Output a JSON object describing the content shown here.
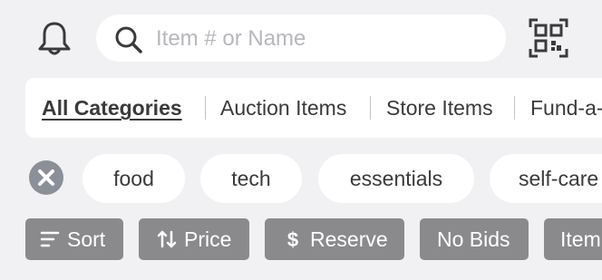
{
  "search": {
    "placeholder": "Item # or Name"
  },
  "categories": {
    "tabs": [
      {
        "label": "All Categories",
        "active": true
      },
      {
        "label": "Auction Items",
        "active": false
      },
      {
        "label": "Store Items",
        "active": false
      },
      {
        "label": "Fund-a-",
        "active": false
      }
    ]
  },
  "tags": {
    "items": [
      {
        "label": "food"
      },
      {
        "label": "tech"
      },
      {
        "label": "essentials"
      },
      {
        "label": "self-care"
      }
    ]
  },
  "filters": {
    "sort_label": "Sort",
    "price_label": "Price",
    "reserve_label": "Reserve",
    "no_bids_label": "No Bids",
    "item_label": "Item"
  },
  "icons": {
    "bell": "bell-icon",
    "search": "search-icon",
    "qr": "qr-code-icon",
    "clear": "close-circle-icon",
    "sort": "sort-lines-icon",
    "price": "up-down-arrows-icon",
    "reserve": "dollar-icon"
  },
  "colors": {
    "background": "#f1f1f3",
    "surface": "#ffffff",
    "filter_button": "#8a8a8d",
    "placeholder": "#b7b7bd",
    "text": "#3a3a3c"
  }
}
